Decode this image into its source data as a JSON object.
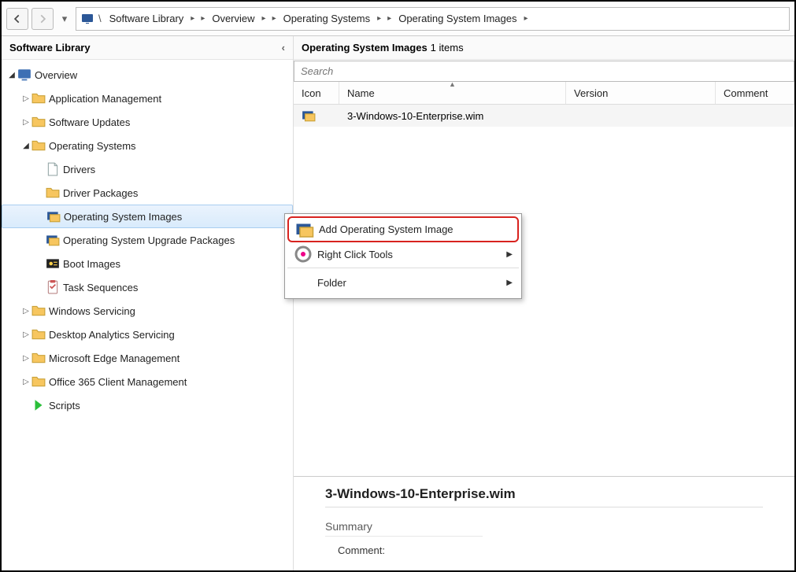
{
  "breadcrumb": {
    "items": [
      "Software Library",
      "Overview",
      "Operating Systems",
      "Operating System Images"
    ]
  },
  "sidebar": {
    "title": "Software Library",
    "nodes": [
      {
        "label": "Overview",
        "depth": 0,
        "expander": "expanded",
        "icon": "console"
      },
      {
        "label": "Application Management",
        "depth": 1,
        "expander": "collapsed",
        "icon": "folder"
      },
      {
        "label": "Software Updates",
        "depth": 1,
        "expander": "collapsed",
        "icon": "folder"
      },
      {
        "label": "Operating Systems",
        "depth": 1,
        "expander": "expanded",
        "icon": "folder"
      },
      {
        "label": "Drivers",
        "depth": 2,
        "expander": "",
        "icon": "doc"
      },
      {
        "label": "Driver Packages",
        "depth": 2,
        "expander": "",
        "icon": "folder"
      },
      {
        "label": "Operating System Images",
        "depth": 2,
        "expander": "",
        "icon": "osimage",
        "selected": true
      },
      {
        "label": "Operating System Upgrade Packages",
        "depth": 2,
        "expander": "",
        "icon": "osimage"
      },
      {
        "label": "Boot Images",
        "depth": 2,
        "expander": "",
        "icon": "boot"
      },
      {
        "label": "Task Sequences",
        "depth": 2,
        "expander": "",
        "icon": "task"
      },
      {
        "label": "Windows Servicing",
        "depth": 1,
        "expander": "collapsed",
        "icon": "folder"
      },
      {
        "label": "Desktop Analytics Servicing",
        "depth": 1,
        "expander": "collapsed",
        "icon": "folder"
      },
      {
        "label": "Microsoft Edge Management",
        "depth": 1,
        "expander": "collapsed",
        "icon": "folder"
      },
      {
        "label": "Office 365 Client Management",
        "depth": 1,
        "expander": "collapsed",
        "icon": "folder"
      },
      {
        "label": "Scripts",
        "depth": 1,
        "expander": "",
        "icon": "script"
      }
    ]
  },
  "main": {
    "title": "Operating System Images",
    "count_suffix": "1 items",
    "search_placeholder": "Search",
    "columns": {
      "icon": "Icon",
      "name": "Name",
      "version": "Version",
      "comment": "Comment"
    },
    "rows": [
      {
        "name": "3-Windows-10-Enterprise.wim",
        "version": "",
        "comment": ""
      }
    ]
  },
  "context_menu": {
    "items": [
      {
        "label": "Add Operating System Image",
        "icon": "osimage",
        "highlight": true,
        "arrow": false
      },
      {
        "label": "Right Click Tools",
        "icon": "tools",
        "highlight": false,
        "arrow": true,
        "sep_after": true
      },
      {
        "label": "Folder",
        "icon": "",
        "highlight": false,
        "arrow": true
      }
    ]
  },
  "detail": {
    "title": "3-Windows-10-Enterprise.wim",
    "section": "Summary",
    "field_label": "Comment:"
  }
}
